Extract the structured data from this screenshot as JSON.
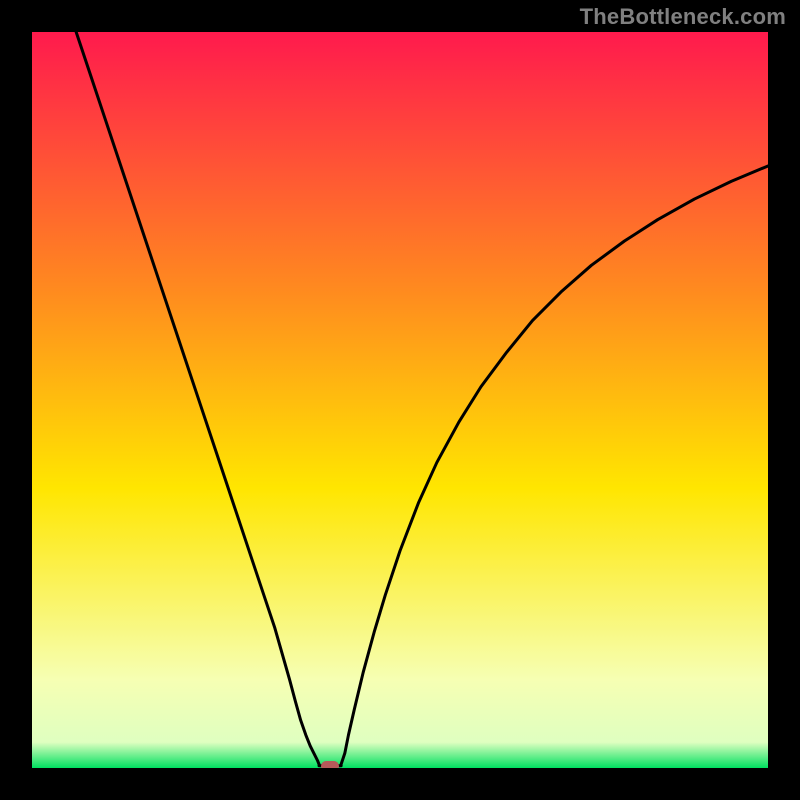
{
  "watermark": "TheBottleneck.com",
  "colors": {
    "frame": "#000000",
    "grad_top": "#ff1a4d",
    "grad_mid1": "#ff8a1f",
    "grad_mid2": "#ffe600",
    "grad_low": "#f6ffb3",
    "grad_bottom": "#00e060",
    "curve": "#000000",
    "marker": "#b55a5a"
  },
  "chart_data": {
    "type": "line",
    "title": "",
    "xlabel": "",
    "ylabel": "",
    "xlim": [
      0,
      100
    ],
    "ylim": [
      0,
      100
    ],
    "gradient_stops": [
      {
        "offset": 0.0,
        "color": "#ff1a4d"
      },
      {
        "offset": 0.35,
        "color": "#ff8a1f"
      },
      {
        "offset": 0.62,
        "color": "#ffe600"
      },
      {
        "offset": 0.88,
        "color": "#f6ffb3"
      },
      {
        "offset": 0.965,
        "color": "#dfffc0"
      },
      {
        "offset": 1.0,
        "color": "#00e060"
      }
    ],
    "series": [
      {
        "name": "left-branch",
        "x": [
          6.0,
          8.0,
          10.0,
          12.5,
          15.0,
          17.5,
          20.0,
          22.5,
          25.0,
          27.5,
          30.0,
          31.5,
          33.0,
          34.0,
          35.0,
          35.8,
          36.5,
          37.2,
          37.8,
          38.3,
          38.8,
          39.0
        ],
        "y": [
          100.0,
          94.0,
          88.0,
          80.5,
          73.0,
          65.5,
          58.0,
          50.5,
          43.0,
          35.5,
          28.0,
          23.5,
          19.0,
          15.5,
          12.0,
          9.0,
          6.5,
          4.5,
          3.0,
          2.0,
          1.0,
          0.5
        ]
      },
      {
        "name": "right-branch",
        "x": [
          42.0,
          42.5,
          43.0,
          43.8,
          45.0,
          46.5,
          48.0,
          50.0,
          52.5,
          55.0,
          58.0,
          61.0,
          64.5,
          68.0,
          72.0,
          76.0,
          80.5,
          85.0,
          90.0,
          95.0,
          100.0
        ],
        "y": [
          0.5,
          2.0,
          4.5,
          8.0,
          13.0,
          18.5,
          23.5,
          29.5,
          36.0,
          41.5,
          47.0,
          51.8,
          56.5,
          60.8,
          64.8,
          68.3,
          71.6,
          74.5,
          77.3,
          79.7,
          81.8
        ]
      }
    ],
    "valley_flat": {
      "x_start": 39.0,
      "x_end": 42.0,
      "y": 0.3
    },
    "marker": {
      "x": 40.5,
      "y": 0.3
    }
  }
}
